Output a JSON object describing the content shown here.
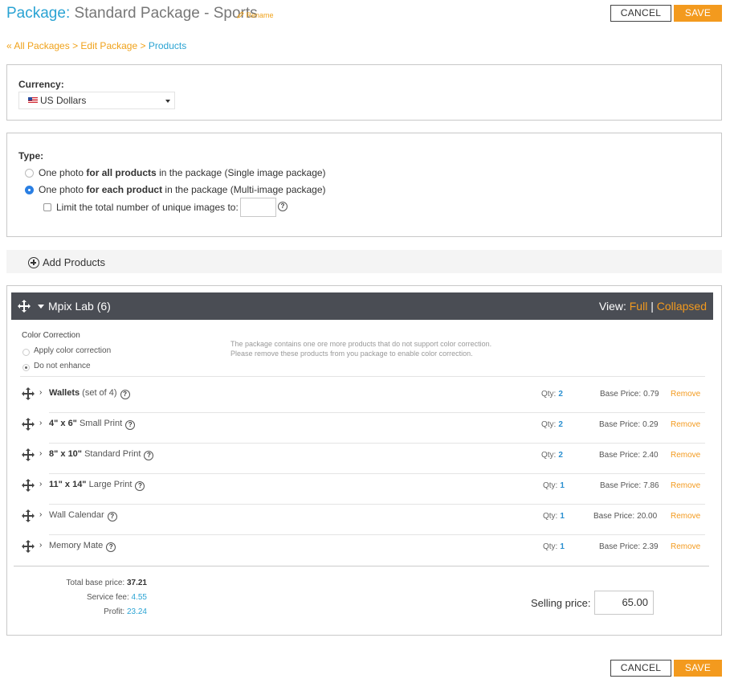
{
  "header": {
    "title_prefix": "Package:",
    "title_name": "Standard Package - Sports",
    "rename": "Rename",
    "cancel": "CANCEL",
    "save": "SAVE"
  },
  "breadcrumb": {
    "all": "« All Packages",
    "sep1": ">",
    "edit": "Edit Package",
    "sep2": ">",
    "current": "Products"
  },
  "currency": {
    "label": "Currency:",
    "selected": "US Dollars"
  },
  "type": {
    "label": "Type:",
    "opt1_pre": "One photo ",
    "opt1_bold": "for all products",
    "opt1_post": " in the package (Single image package)",
    "opt2_pre": "One photo ",
    "opt2_bold": "for each product",
    "opt2_post": " in the package (Multi-image package)",
    "limit": "Limit the total number of unique images to:",
    "limit_value": "",
    "help": "?"
  },
  "add_products": "Add Products",
  "lab": {
    "title": "Mpix Lab (6)",
    "view": "View:",
    "full": "Full",
    "bar": "|",
    "collapsed": "Collapsed",
    "color_correction": "Color Correction",
    "apply": "Apply color correction",
    "no_enhance": "Do not enhance",
    "notice": "The package contains one ore more products that do not support color correction. Please remove these products from you package to enable color correction."
  },
  "products": [
    {
      "bold": "Wallets",
      "rest": " (set of 4)",
      "qty_label": "Qty:",
      "qty": "2",
      "base_label": "Base Price:",
      "base": "0.79",
      "remove": "Remove"
    },
    {
      "bold": "4\" x 6\"",
      "rest": " Small Print",
      "qty_label": "Qty:",
      "qty": "2",
      "base_label": "Base Price:",
      "base": "0.29",
      "remove": "Remove"
    },
    {
      "bold": "8\" x 10\"",
      "rest": " Standard Print",
      "qty_label": "Qty:",
      "qty": "2",
      "base_label": "Base Price:",
      "base": "2.40",
      "remove": "Remove"
    },
    {
      "bold": "11\" x 14\"",
      "rest": " Large Print",
      "qty_label": "Qty:",
      "qty": "1",
      "base_label": "Base Price:",
      "base": "7.86",
      "remove": "Remove"
    },
    {
      "bold": "",
      "rest": "Wall Calendar",
      "qty_label": "Qty:",
      "qty": "1",
      "base_label": "Base Price:",
      "base": "20.00",
      "remove": "Remove"
    },
    {
      "bold": "",
      "rest": "Memory Mate",
      "qty_label": "Qty:",
      "qty": "1",
      "base_label": "Base Price:",
      "base": "2.39",
      "remove": "Remove"
    }
  ],
  "totals": {
    "base_label": "Total base price:",
    "base": "37.21",
    "fee_label": "Service fee:",
    "fee": "4.55",
    "profit_label": "Profit:",
    "profit": "23.24",
    "selling_label": "Selling price:",
    "selling": "65.00"
  },
  "footer": {
    "cancel": "CANCEL",
    "save": "SAVE"
  }
}
